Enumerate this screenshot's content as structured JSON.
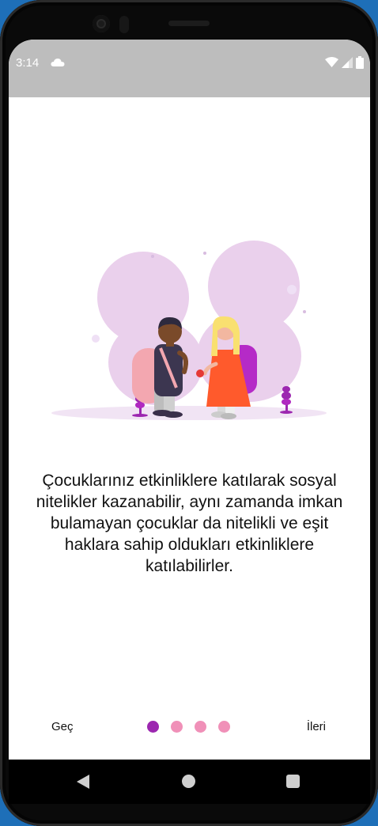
{
  "status_bar": {
    "time": "3:14",
    "icons": [
      "cloud-icon",
      "wifi-icon",
      "signal-icon",
      "battery-icon"
    ]
  },
  "illustration": {
    "description_icon": "children-with-backpacks-illustration"
  },
  "onboarding": {
    "description": "Çocuklarınız etkinliklere katılarak sosyal nitelikler kazanabilir, aynı zamanda imkan bulamayan çocuklar da nitelikli ve eşit haklara sahip oldukları etkinliklere katılabilirler.",
    "skip_label": "Geç",
    "next_label": "İleri",
    "page_count": 4,
    "current_page": 1
  },
  "colors": {
    "accent": "#9c27b0",
    "dot_inactive": "#f090b8",
    "status_bar": "#bdbdbd"
  },
  "nav_bar": {
    "icons": [
      "back-icon",
      "home-icon",
      "recents-icon"
    ]
  }
}
